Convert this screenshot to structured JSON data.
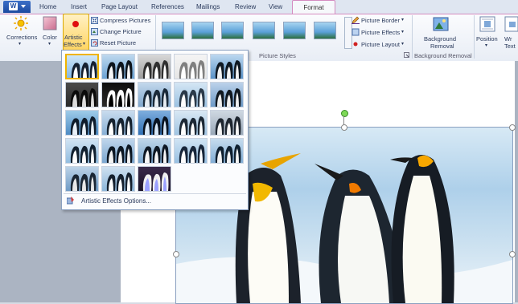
{
  "tabs": [
    "Home",
    "Insert",
    "Page Layout",
    "References",
    "Mailings",
    "Review",
    "View",
    "Format"
  ],
  "adjust": {
    "corrections": "Corrections",
    "color": "Color",
    "artistic_effects_line1": "Artistic",
    "artistic_effects_line2": "Effects",
    "compress": "Compress Pictures",
    "change": "Change Picture",
    "reset": "Reset Picture"
  },
  "picture_styles": {
    "group_label": "Picture Styles",
    "border": "Picture Border",
    "effects": "Picture Effects",
    "layout": "Picture Layout"
  },
  "background": {
    "label_line1": "Background",
    "label_line2": "Removal",
    "group_label": "Background Removal"
  },
  "arrange": {
    "position": "Position",
    "wrap_line1": "Wr",
    "wrap_line2": "Text"
  },
  "dropdown": {
    "options_label": "Artistic Effects Options...",
    "grid_rows": 5,
    "grid_cols": 5,
    "item_count": 23,
    "selected_index": 0
  },
  "colors": {
    "accent_format": "#d48bc0",
    "selected_effect": "#f0b400",
    "file_button": "#1c4aa0"
  }
}
